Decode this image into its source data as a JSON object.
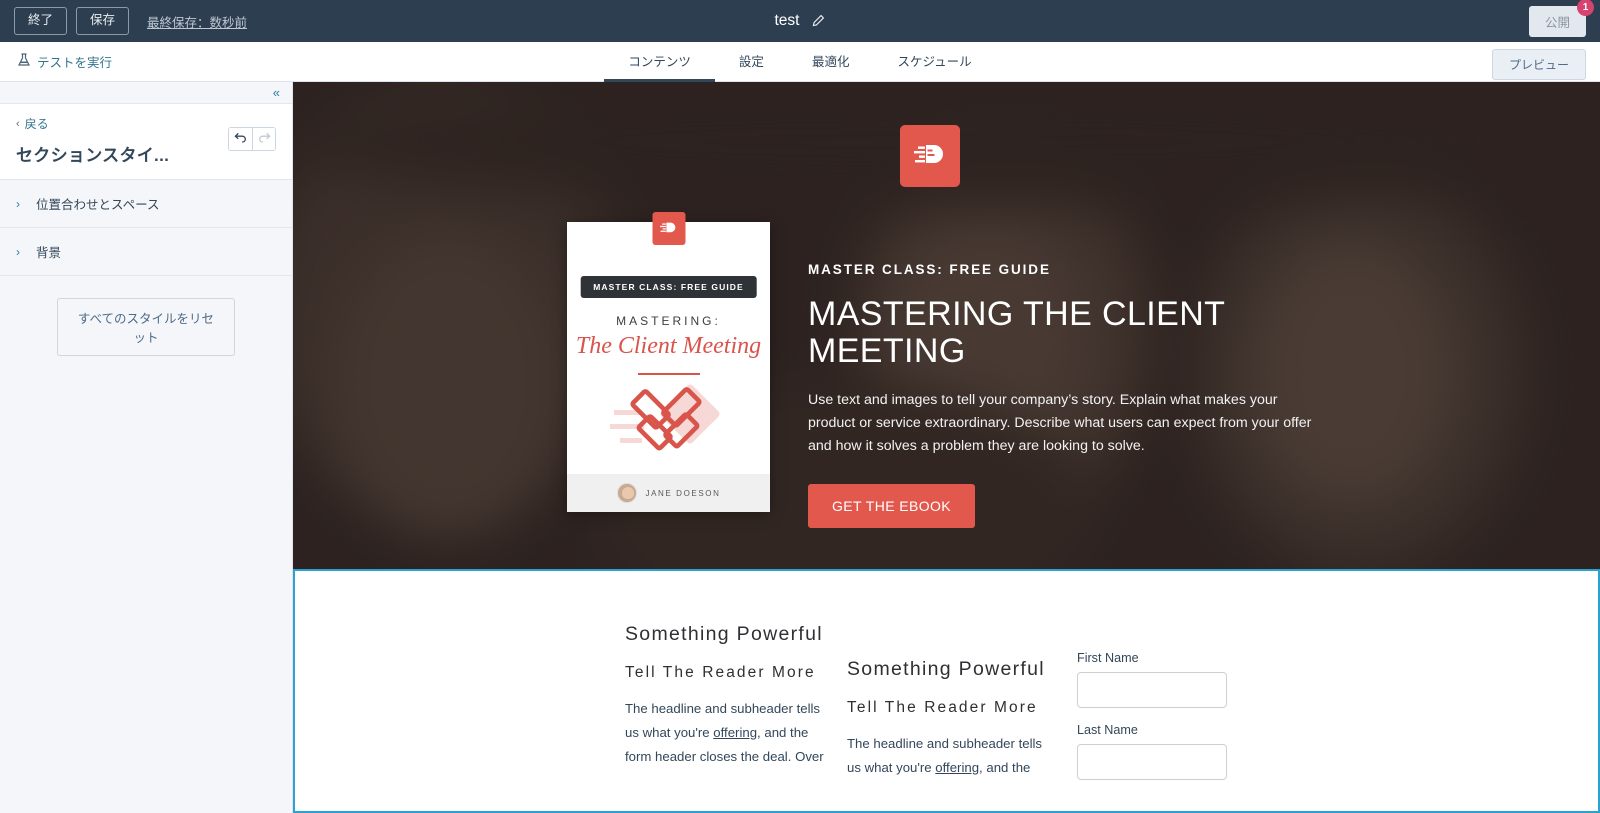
{
  "topbar": {
    "exit_label": "終了",
    "save_label": "保存",
    "last_saved_label": "最終保存：数秒前",
    "page_title": "test",
    "edit_icon": "pencil-icon",
    "publish_label": "公開",
    "publish_badge_count": "1",
    "bg_color": "#2d3e50"
  },
  "navbar": {
    "run_test_label": "テストを実行",
    "run_test_icon": "flask-icon",
    "tabs": [
      {
        "label": "コンテンツ",
        "active": true
      },
      {
        "label": "設定",
        "active": false
      },
      {
        "label": "最適化",
        "active": false
      },
      {
        "label": "スケジュール",
        "active": false
      }
    ],
    "preview_label": "プレビュー"
  },
  "sidebar": {
    "collapse_icon": "double-chevron-left-icon",
    "back_label": "戻る",
    "panel_title": "セクションスタイ...",
    "undo_icon": "undo-arrow-icon",
    "redo_icon": "redo-arrow-icon",
    "sections": [
      {
        "label": "位置合わせとスペース"
      },
      {
        "label": "背景"
      }
    ],
    "reset_label": "すべてのスタイルをリセット"
  },
  "canvas": {
    "hero": {
      "logo_icon": "brand-logo-icon",
      "accent_color": "#e2584d",
      "eyebrow": "MASTER CLASS: FREE GUIDE",
      "title": "MASTERING THE CLIENT MEETING",
      "body": "Use text and images to tell your company’s story. Explain what makes your product or service extraordinary. Describe what users can expect from your offer and how it solves a problem they are looking to solve.",
      "cta_label": "GET THE EBOOK",
      "ebook": {
        "logo_icon": "brand-logo-icon",
        "badge": "MASTER CLASS: FREE GUIDE",
        "title_line1": "MASTERING:",
        "title_line2": "The Client Meeting",
        "art_icon": "handshake-illustration",
        "author": "JANE DOESON",
        "avatar_icon": "author-avatar"
      }
    },
    "lower": {
      "selection_color": "#2aa4cf",
      "columns": [
        {
          "heading": "Something Powerful",
          "subheading": "Tell The Reader More",
          "body_before": "The headline and subheader tells us what you're ",
          "body_link": "offering",
          "body_after": ", and the form header closes the deal. Over"
        },
        {
          "heading": "Something Powerful",
          "subheading": "Tell The Reader More",
          "body_before": "The headline and subheader tells us what you're ",
          "body_link": "offering",
          "body_after": ", and the"
        }
      ],
      "form": {
        "fields": [
          {
            "label": "First Name",
            "value": ""
          },
          {
            "label": "Last Name",
            "value": ""
          }
        ]
      }
    }
  }
}
